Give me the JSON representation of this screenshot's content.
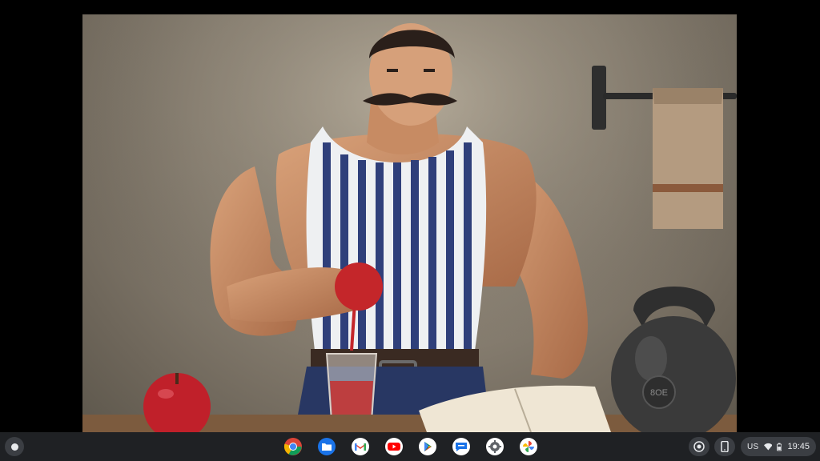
{
  "wallpaper": {
    "kettlebell_text": "8OE"
  },
  "shelf": {
    "launcher_icon": "launcher-circle-icon",
    "apps": [
      {
        "name": "chrome",
        "icon": "chrome-icon"
      },
      {
        "name": "files",
        "icon": "files-icon"
      },
      {
        "name": "gmail",
        "icon": "gmail-icon"
      },
      {
        "name": "youtube",
        "icon": "youtube-icon"
      },
      {
        "name": "play-store",
        "icon": "play-store-icon"
      },
      {
        "name": "messages",
        "icon": "messages-icon"
      },
      {
        "name": "settings",
        "icon": "settings-gear-icon"
      },
      {
        "name": "photos",
        "icon": "photos-pinwheel-icon"
      }
    ],
    "tray": {
      "keyboard_layout": "US",
      "time": "19:45"
    }
  },
  "colors": {
    "shelf_bg": "#1f2124",
    "pill_bg": "#3b3e43",
    "text": "#e8eaed"
  }
}
